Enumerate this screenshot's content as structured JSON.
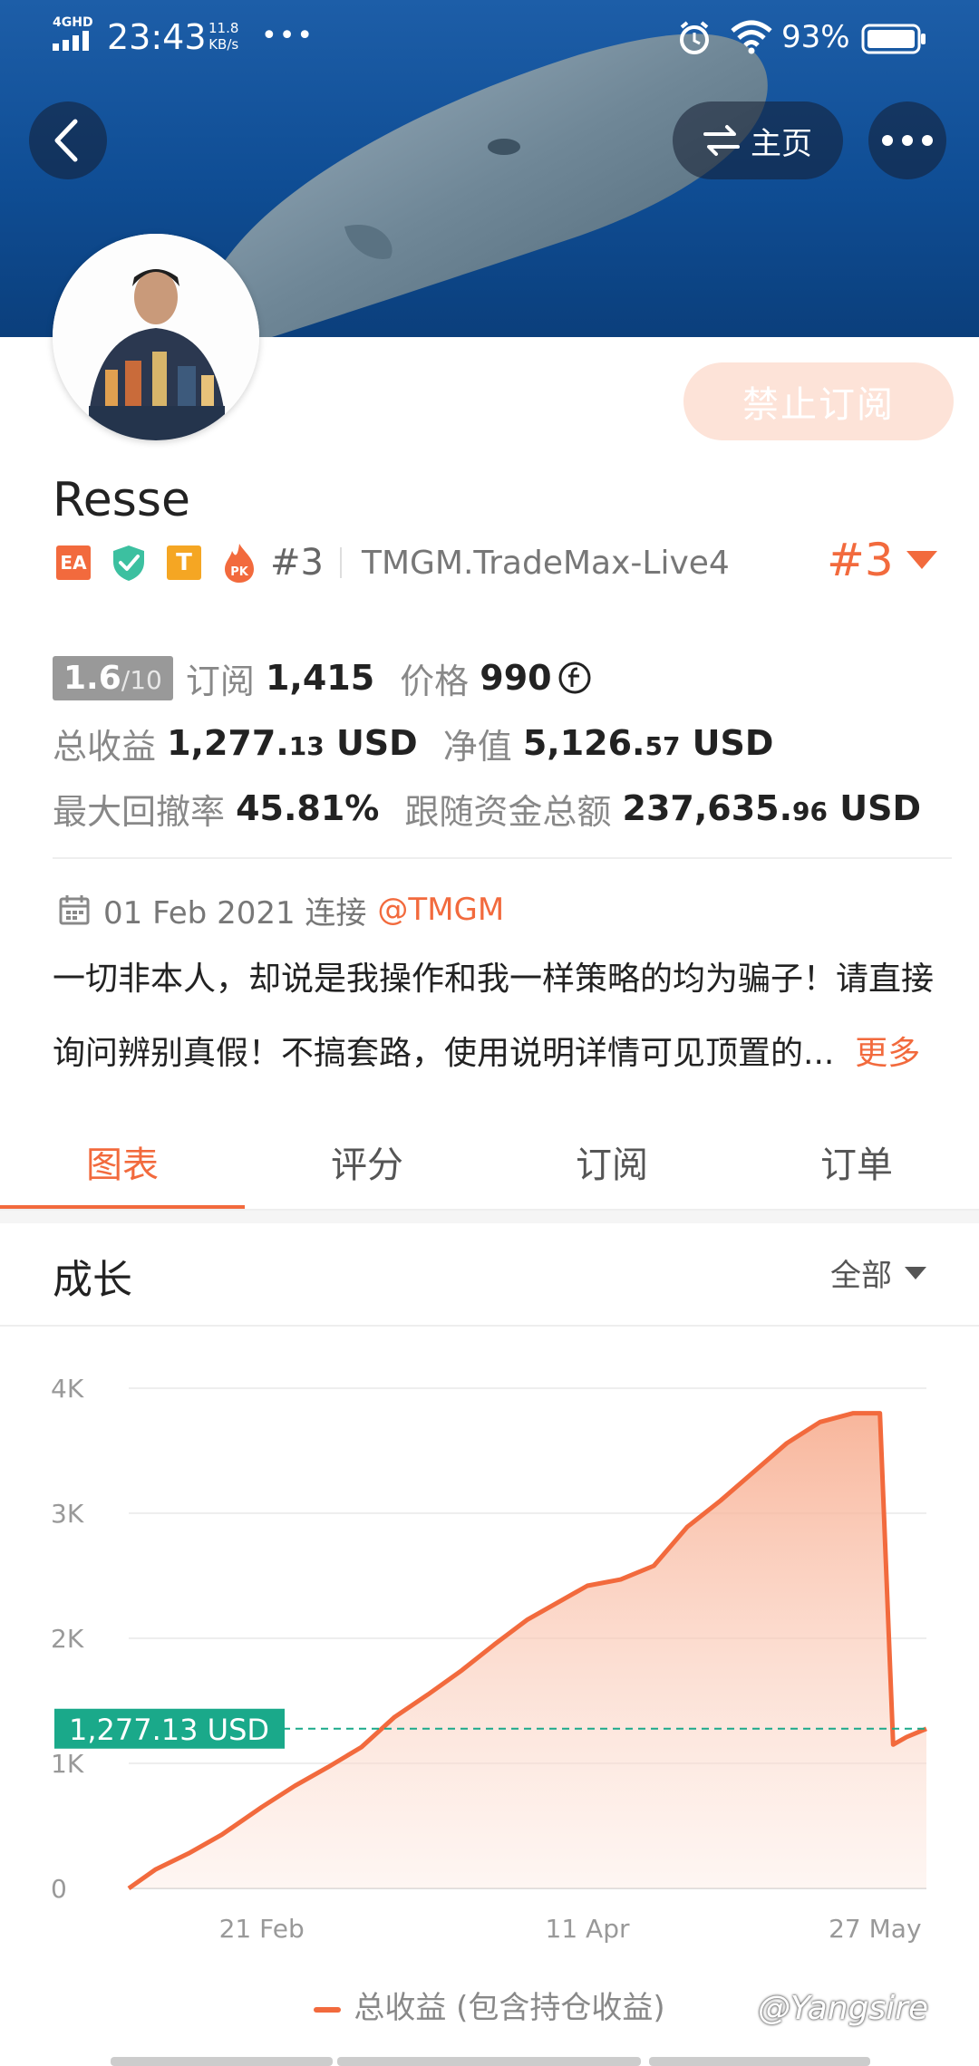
{
  "status_bar": {
    "network": "4GHD",
    "time": "23:43",
    "speed_value": "11.8",
    "speed_unit": "KB/s",
    "dots": "•••",
    "battery": "93%"
  },
  "header": {
    "home_label": "主页",
    "subscribe_label": "禁止订阅"
  },
  "profile": {
    "name": "Resse",
    "badge_ea": "EA",
    "badge_t": "T",
    "badge_pk": "PK",
    "rank_small": "#3",
    "server": "TMGM.TradeMax-Live4",
    "rank_big": "#3"
  },
  "stats": {
    "score": "1.6",
    "score_den": "/10",
    "subs_label": "订阅",
    "subs_value": "1,415",
    "price_label": "价格",
    "price_value": "990",
    "profit_label": "总收益",
    "profit_int": "1,277.",
    "profit_dec": "13",
    "profit_unit": " USD",
    "equity_label": "净值",
    "equity_int": "5,126.",
    "equity_dec": "57",
    "equity_unit": " USD",
    "drawdown_label": "最大回撤率",
    "drawdown_value": "45.81%",
    "follow_label": "跟随资金总额",
    "follow_int": "237,635.",
    "follow_dec": "96",
    "follow_unit": " USD"
  },
  "connection": {
    "date": "01 Feb 2021 连接",
    "broker": "@TMGM"
  },
  "description": {
    "line1": "一切非本人，却说是我操作和我一样策略的均为骗子！请直接",
    "line2": "询问辨别真假！不搞套路，使用说明详情可见顶置的...",
    "more": "更多"
  },
  "tabs": [
    {
      "label": "图表",
      "active": true
    },
    {
      "label": "评分",
      "active": false
    },
    {
      "label": "订阅",
      "active": false
    },
    {
      "label": "订单",
      "active": false
    }
  ],
  "section": {
    "title": "成长",
    "filter": "全部"
  },
  "chart_data": {
    "type": "area",
    "title": "",
    "y_ticks": [
      "4K",
      "3K",
      "2K",
      "1K",
      "0"
    ],
    "ylim": [
      0,
      4000
    ],
    "x_ticks": [
      "21 Feb",
      "11 Apr",
      "27 May"
    ],
    "grid": true,
    "current_label": "1,277.13 USD",
    "current_value": 1277.13,
    "series": [
      {
        "name": "总收益 (包含持仓收益)",
        "color": "#f26a3d",
        "x": [
          "2021-02-01",
          "2021-02-05",
          "2021-02-10",
          "2021-02-15",
          "2021-02-21",
          "2021-02-26",
          "2021-03-03",
          "2021-03-08",
          "2021-03-13",
          "2021-03-18",
          "2021-03-23",
          "2021-03-28",
          "2021-04-02",
          "2021-04-07",
          "2021-04-11",
          "2021-04-16",
          "2021-04-21",
          "2021-04-26",
          "2021-05-01",
          "2021-05-06",
          "2021-05-11",
          "2021-05-16",
          "2021-05-21",
          "2021-05-25",
          "2021-05-27",
          "2021-05-29",
          "2021-06-01"
        ],
        "values": [
          0,
          150,
          280,
          430,
          650,
          820,
          970,
          1130,
          1370,
          1550,
          1740,
          1950,
          2150,
          2300,
          2420,
          2470,
          2580,
          2890,
          3100,
          3330,
          3560,
          3730,
          3800,
          3800,
          1150,
          1210,
          1277
        ]
      }
    ]
  },
  "watermark": "@Yangsire"
}
